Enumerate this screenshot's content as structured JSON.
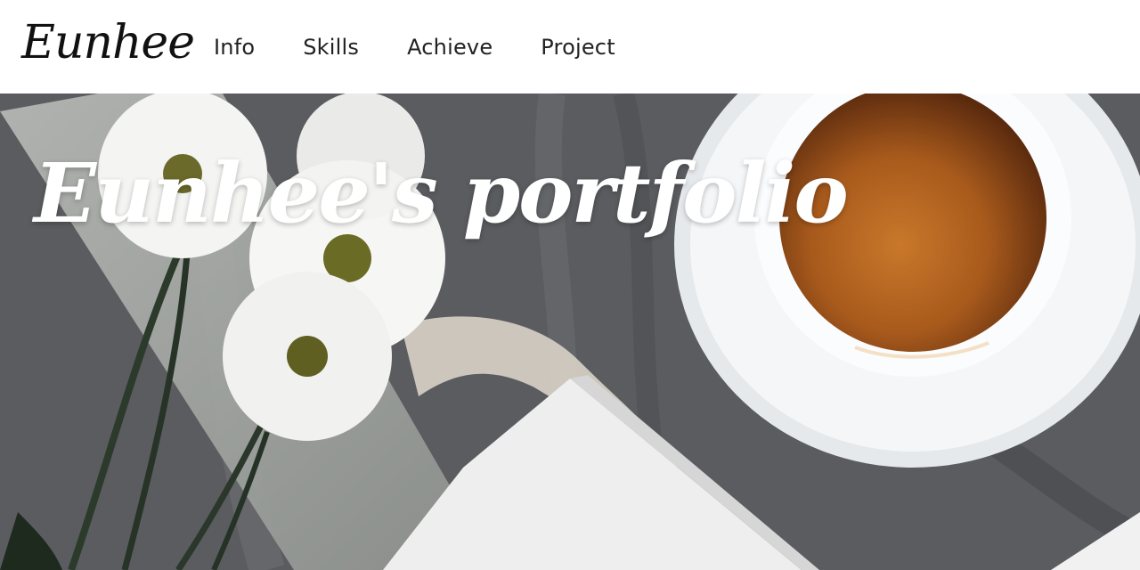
{
  "header": {
    "brand": "Eunhee",
    "nav": [
      "Info",
      "Skills",
      "Achieve",
      "Project"
    ]
  },
  "hero": {
    "title": "Eunhee's portfolio",
    "image_subject": "daisies, lace ribbon, open book and a cup of tea on grey fabric"
  },
  "colors": {
    "header_bg": "#ffffff",
    "text_dark": "#222222",
    "hero_title": "#ffffff",
    "tea": "#b0621f",
    "fabric": "#5d5e62"
  }
}
